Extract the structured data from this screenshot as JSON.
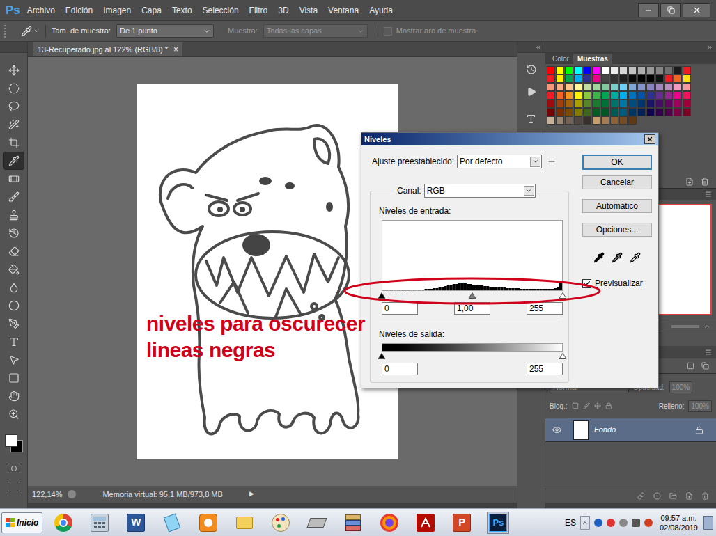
{
  "app": {
    "logo": "Ps"
  },
  "menu": [
    "Archivo",
    "Edición",
    "Imagen",
    "Capa",
    "Texto",
    "Selección",
    "Filtro",
    "3D",
    "Vista",
    "Ventana",
    "Ayuda"
  ],
  "options_bar": {
    "size_label": "Tam. de muestra:",
    "size_value": "De 1 punto",
    "sample_label": "Muestra:",
    "sample_value": "Todas las capas",
    "sample_disabled": true,
    "ring": {
      "label": "Mostrar aro de muestra",
      "checked": false,
      "disabled": true
    }
  },
  "tools": [
    {
      "selected": false
    },
    {
      "selected": false
    },
    {
      "selected": false
    },
    {
      "selected": false
    },
    {
      "selected": false
    },
    {
      "selected": true
    },
    {
      "selected": false
    },
    {
      "selected": false
    },
    {
      "selected": false
    },
    {
      "selected": false
    },
    {
      "selected": false
    },
    {
      "selected": false
    },
    {
      "selected": false
    },
    {
      "selected": false
    },
    {
      "selected": false
    },
    {
      "selected": false
    },
    {
      "selected": false
    },
    {
      "selected": false
    },
    {
      "selected": false
    },
    {
      "selected": false
    }
  ],
  "colors": {
    "foreground": "#ffffff",
    "background": "#000000"
  },
  "document": {
    "tab": "13-Recuperado.jpg al 122% (RGB/8) *",
    "close": "×"
  },
  "annotation": [
    "niveles para oscurecer",
    "lineas negras"
  ],
  "status_bar": {
    "zoom": "122,14%",
    "memory": "Memoria virtual: 95,1 MB/973,8 MB",
    "arrow": "▶"
  },
  "dialog": {
    "title": "Niveles",
    "preset_label": "Ajuste preestablecido:",
    "preset": "Por defecto",
    "channel_label": "Canal:",
    "channel": "RGB",
    "input_label": "Niveles de entrada:",
    "histogram": [
      0,
      1,
      0,
      0,
      1,
      0,
      0,
      1,
      0,
      1,
      0,
      1,
      1,
      1,
      1,
      2,
      2,
      2,
      3,
      3,
      4,
      5,
      6,
      7,
      8,
      9,
      9,
      10,
      10,
      10,
      9,
      9,
      8,
      8,
      7,
      7,
      6,
      6,
      5,
      5,
      5,
      4,
      4,
      4,
      3,
      3,
      3,
      3,
      3,
      2,
      2,
      2,
      2,
      2,
      2,
      2,
      2,
      2,
      2,
      2,
      2,
      3,
      4,
      12
    ],
    "input_sliders": [
      {
        "level": 0,
        "kind": "black"
      },
      {
        "level": 0.5,
        "kind": "gray"
      },
      {
        "level": 1,
        "kind": "white"
      }
    ],
    "input_values": [
      "0",
      "1,00",
      "255"
    ],
    "output_label": "Niveles de salida:",
    "output_sliders": [
      {
        "level": 0,
        "kind": "black"
      },
      {
        "level": 1,
        "kind": "white"
      }
    ],
    "output_values": [
      "0",
      "255"
    ],
    "buttons": [
      {
        "label": "OK",
        "default": true
      },
      {
        "label": "Cancelar",
        "default": false
      },
      {
        "label": "Automático",
        "default": false
      },
      {
        "label": "Opciones...",
        "default": false
      }
    ],
    "preview": {
      "label": "Previsualizar",
      "checked": true
    }
  },
  "panels": {
    "tabs": [
      {
        "label": "Color",
        "selected": false
      },
      {
        "label": "Muestras",
        "selected": true
      }
    ],
    "swatches": [
      "#ff0000",
      "#ffff00",
      "#00ff00",
      "#00ffff",
      "#0000ff",
      "#ff00ff",
      "#ffffff",
      "#ebebeb",
      "#d6d6d6",
      "#c2c2c2",
      "#adadad",
      "#999999",
      "#858585",
      "#707070",
      "#1a1a1a",
      "#ed1c24",
      "#ee1d24",
      "#fff100",
      "#00a650",
      "#00adef",
      "#2e3192",
      "#ec008c",
      "#474747",
      "#333333",
      "#1f1f1f",
      "#0a0a0a",
      "#000000",
      "#000000",
      "#111111",
      "#ed1c24",
      "#f26522",
      "#ffde17",
      "#f7977a",
      "#f9ad81",
      "#fdc68a",
      "#fff79a",
      "#c4df9b",
      "#a2d39c",
      "#82ca9d",
      "#7bcdc8",
      "#6ecff6",
      "#7ea7d8",
      "#8493ca",
      "#8882be",
      "#a187be",
      "#bc8dbf",
      "#f49ac2",
      "#f6989d",
      "#ed1c24",
      "#f26522",
      "#f7941d",
      "#fff200",
      "#8dc63f",
      "#39b54a",
      "#00a651",
      "#00a99d",
      "#00aeef",
      "#0072bc",
      "#0054a6",
      "#2e3192",
      "#662d91",
      "#92278f",
      "#ec008c",
      "#ed145b",
      "#9e0b0f",
      "#a0410d",
      "#a36209",
      "#aba000",
      "#598527",
      "#1a7b30",
      "#007236",
      "#00746b",
      "#0076a3",
      "#004b80",
      "#003471",
      "#1b1464",
      "#440e62",
      "#630460",
      "#9e005d",
      "#9e0039",
      "#790000",
      "#7b2e00",
      "#7d4900",
      "#827b00",
      "#406618",
      "#005e20",
      "#005826",
      "#005952",
      "#005b7f",
      "#003663",
      "#002157",
      "#0d004c",
      "#32004b",
      "#4b0049",
      "#7b0046",
      "#7a0026",
      "#c7b299",
      "#998675",
      "#736357",
      "#534741",
      "#37302d",
      "#c69c6d",
      "#a67c52",
      "#8c6239",
      "#754c24",
      "#603913"
    ],
    "layers": {
      "blend": "Normal",
      "opacity_label": "Opacidad:",
      "opacity": "100%",
      "lock_label": "Bloq.:",
      "fill_label": "Relleno:",
      "fill": "100%",
      "controls_disabled": true,
      "items": [
        {
          "name": "Fondo",
          "visible": true,
          "locked": true,
          "selected": true
        }
      ]
    }
  },
  "taskbar": {
    "start": "Inicio",
    "apps": [
      {
        "kind": "chrome",
        "glyph": "",
        "selected": false
      },
      {
        "kind": "calc",
        "glyph": "",
        "selected": false
      },
      {
        "kind": "word",
        "glyph": "W",
        "selected": false
      },
      {
        "kind": "notepad",
        "glyph": "",
        "selected": false
      },
      {
        "kind": "media",
        "glyph": "",
        "selected": false
      },
      {
        "kind": "folder",
        "glyph": "",
        "selected": false
      },
      {
        "kind": "paint",
        "glyph": "",
        "selected": false
      },
      {
        "kind": "scanner",
        "glyph": "",
        "selected": false
      },
      {
        "kind": "archive",
        "glyph": "",
        "selected": false
      },
      {
        "kind": "firefox",
        "glyph": "",
        "selected": false
      },
      {
        "kind": "acrobat",
        "glyph": "",
        "selected": false
      },
      {
        "kind": "powerpoint",
        "glyph": "P",
        "selected": false
      },
      {
        "kind": "photoshop",
        "glyph": "Ps",
        "selected": true
      }
    ],
    "language": "ES",
    "time": "09:57 a.m.",
    "date": "02/08/2019"
  }
}
